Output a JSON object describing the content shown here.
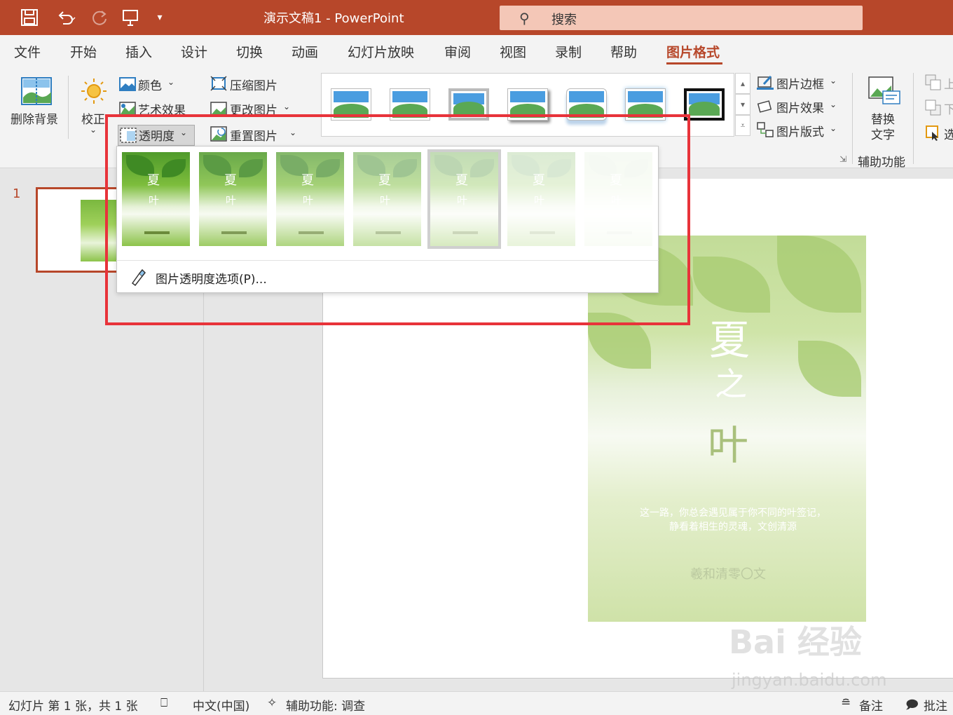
{
  "titlebar": {
    "title": "演示文稿1 - PowerPoint",
    "search_placeholder": "搜索"
  },
  "tabs": [
    "文件",
    "开始",
    "插入",
    "设计",
    "切换",
    "动画",
    "幻灯片放映",
    "审阅",
    "视图",
    "录制",
    "帮助",
    "图片格式"
  ],
  "active_tab": "图片格式",
  "ribbon": {
    "remove_background": "删除背景",
    "corrections": "校正",
    "color": "颜色",
    "artistic_effects": "艺术效果",
    "transparency": "透明度",
    "compress": "压缩图片",
    "change": "更改图片",
    "reset": "重置图片",
    "picture_border": "图片边框",
    "picture_effects": "图片效果",
    "picture_layout": "图片版式",
    "alt_text_line1": "替换",
    "alt_text_line2": "文字",
    "accessibility_group": "辅助功能",
    "bring_forward": "上",
    "send_backward": "下",
    "selection": "选"
  },
  "transparency_menu": {
    "presets": [
      "0%",
      "15%",
      "30%",
      "50%",
      "65%",
      "80%",
      "95%"
    ],
    "selected_index": 4,
    "options_label": "图片透明度选项(P)..."
  },
  "slides": {
    "current_number": "1"
  },
  "poster": {
    "title_1": "夏",
    "title_2": "之",
    "title_3": "叶",
    "body_line_1": "这一路，你总会遇见属于你不同的叶签记，",
    "body_line_2": "静看着相生的灵魂，文创清源",
    "author": "羲和清零〇文"
  },
  "statusbar": {
    "slide_info": "幻灯片 第 1 张，共 1 张",
    "language": "中文(中国)",
    "accessibility": "辅助功能: 调查",
    "notes": "备注",
    "comments": "批注"
  },
  "watermark": {
    "brand": "Bai 经验",
    "url": "jingyan.baidu.com"
  },
  "colors": {
    "accent": "#b7472a",
    "highlight": "#e8333a"
  }
}
